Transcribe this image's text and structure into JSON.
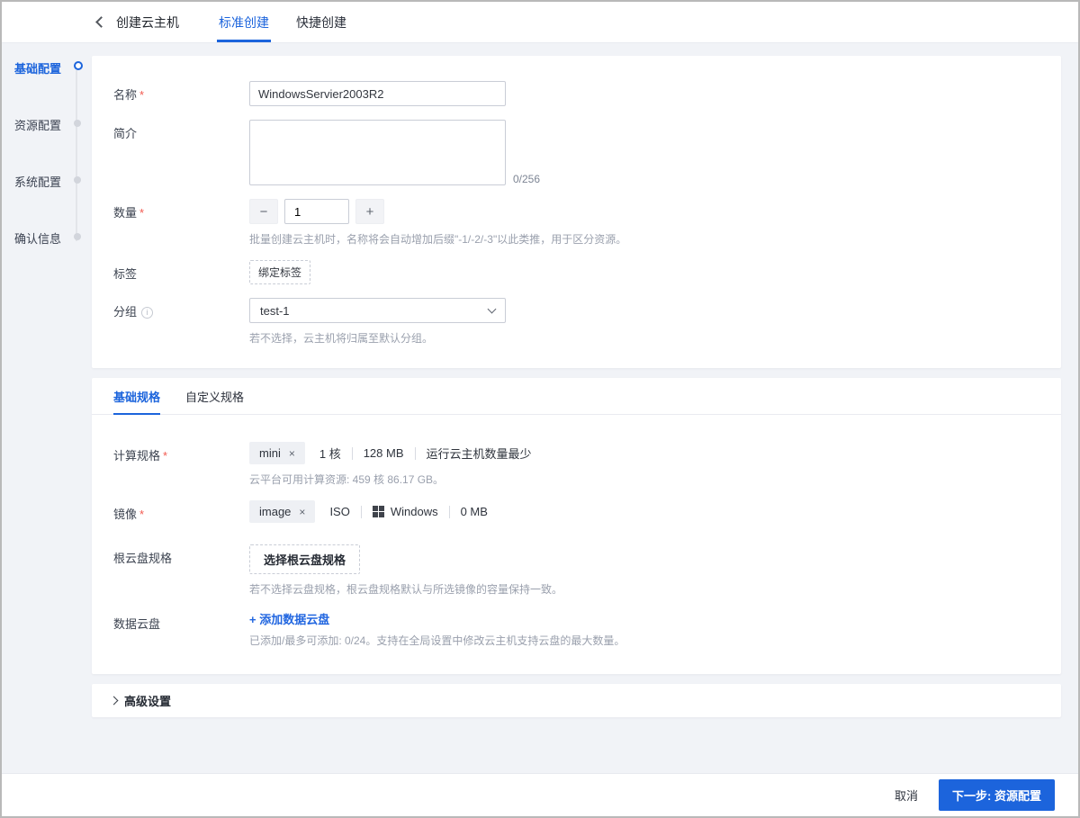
{
  "header": {
    "title": "创建云主机",
    "tabs": [
      {
        "label": "标准创建"
      },
      {
        "label": "快捷创建"
      }
    ]
  },
  "steps": [
    {
      "label": "基础配置"
    },
    {
      "label": "资源配置"
    },
    {
      "label": "系统配置"
    },
    {
      "label": "确认信息"
    }
  ],
  "required_mark": "*",
  "basic": {
    "name_label": "名称",
    "name_value": "WindowsServier2003R2",
    "desc_label": "简介",
    "desc_counter": "0/256",
    "count_label": "数量",
    "count_minus": "−",
    "count_plus": "+",
    "count_value": "1",
    "count_help": "批量创建云主机时，名称将会自动增加后缀\"-1/-2/-3\"以此类推，用于区分资源。",
    "tag_label": "标签",
    "tag_button": "绑定标签",
    "group_label": "分组",
    "group_info": "i",
    "group_value": "test-1",
    "group_help": "若不选择，云主机将归属至默认分组。"
  },
  "spec": {
    "tabs": [
      {
        "label": "基础规格"
      },
      {
        "label": "自定义规格"
      }
    ],
    "compute_label": "计算规格",
    "compute_tag": "mini",
    "tag_remove": "×",
    "compute_spec_1": "1 核",
    "compute_spec_2": "128 MB",
    "compute_spec_3": "运行云主机数量最少",
    "compute_help": "云平台可用计算资源: 459 核 86.17 GB。",
    "image_label": "镜像",
    "image_tag": "image",
    "image_spec_1": "ISO",
    "image_spec_2": "Windows",
    "image_spec_3": "0 MB",
    "rootdisk_label": "根云盘规格",
    "rootdisk_button": "选择根云盘规格",
    "rootdisk_help": "若不选择云盘规格，根云盘规格默认与所选镜像的容量保持一致。",
    "datadisk_label": "数据云盘",
    "datadisk_link": "+ 添加数据云盘",
    "datadisk_help": "已添加/最多可添加: 0/24。支持在全局设置中修改云主机支持云盘的最大数量。"
  },
  "advanced": {
    "label": "高级设置"
  },
  "footer": {
    "cancel": "取消",
    "next": "下一步: 资源配置"
  },
  "colors": {
    "primary": "#1c64dc",
    "required": "#f25a50"
  }
}
